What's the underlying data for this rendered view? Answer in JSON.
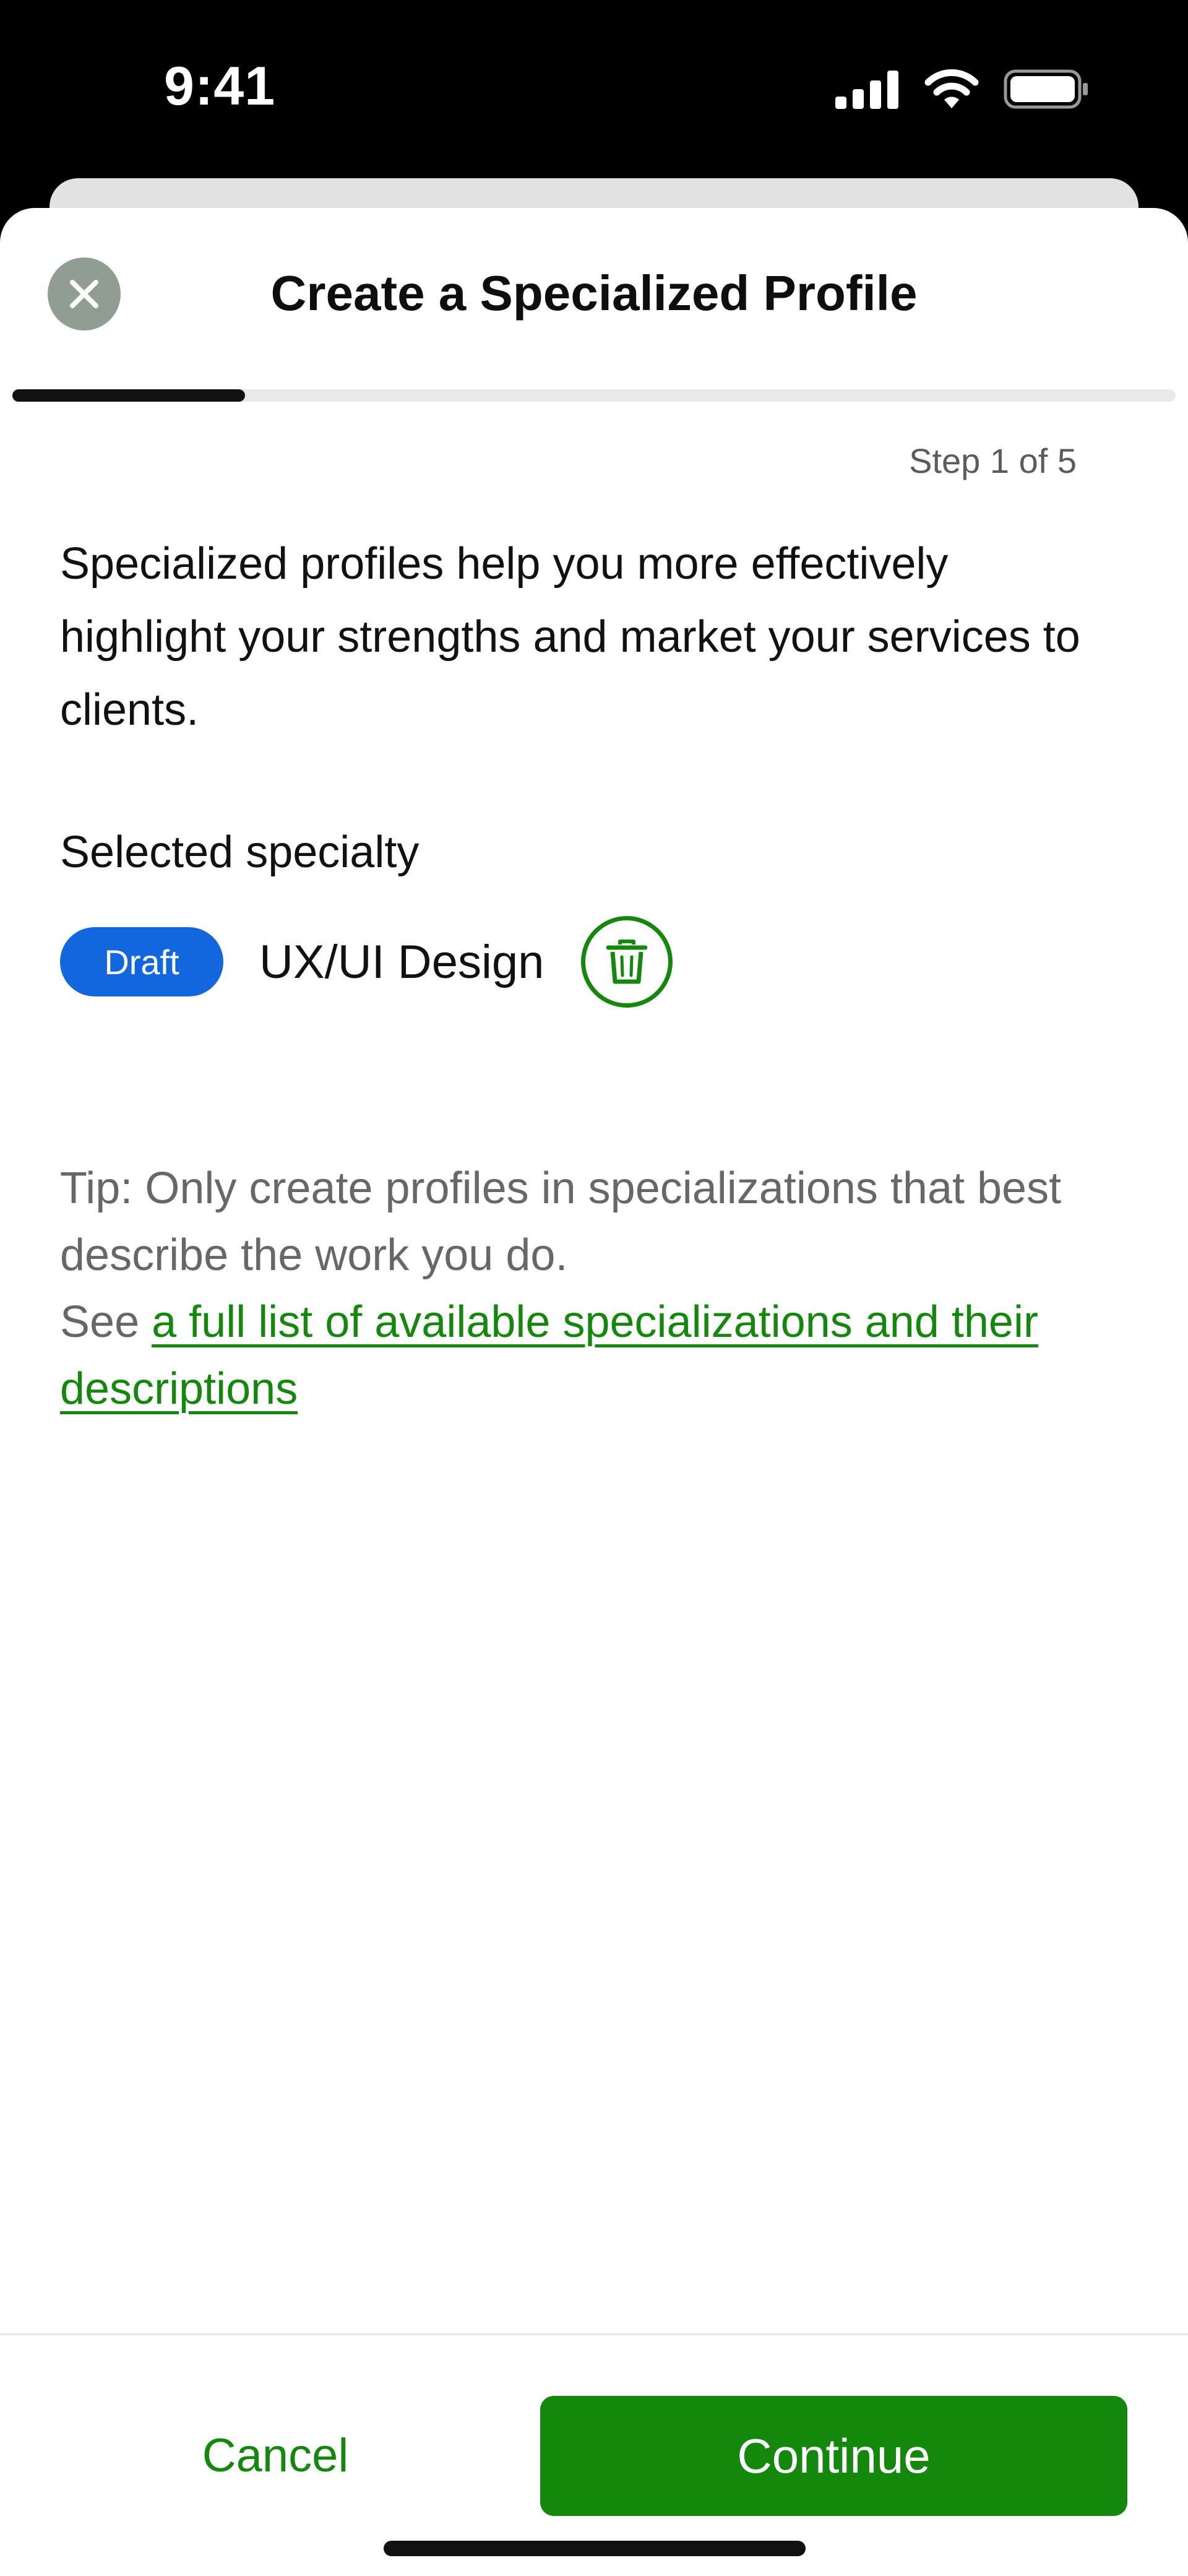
{
  "status_bar": {
    "time": "9:41",
    "icons": [
      "signal-icon",
      "wifi-icon",
      "battery-icon"
    ]
  },
  "header": {
    "title": "Create a Specialized Profile",
    "close_icon": "close-icon"
  },
  "progress": {
    "fraction": 0.2,
    "step_label": "Step 1 of 5"
  },
  "content": {
    "intro": "Specialized profiles help you more effectively highlight your strengths and market your services to clients.",
    "selected_heading": "Selected specialty",
    "specialty": {
      "badge": "Draft",
      "name": "UX/UI Design",
      "delete_icon": "trash-icon"
    },
    "tip_line": "Tip: Only create profiles in specializations that best describe the work you do.",
    "see_prefix": "See ",
    "see_link": "a full list of available specializations and their descriptions"
  },
  "footer": {
    "cancel_label": "Cancel",
    "continue_label": "Continue"
  },
  "colors": {
    "brand_green": "#14880c",
    "draft_blue": "#1267df",
    "close_button": "#8f9d93",
    "progress_fill": "#111111",
    "progress_track": "#e9e9e9"
  }
}
